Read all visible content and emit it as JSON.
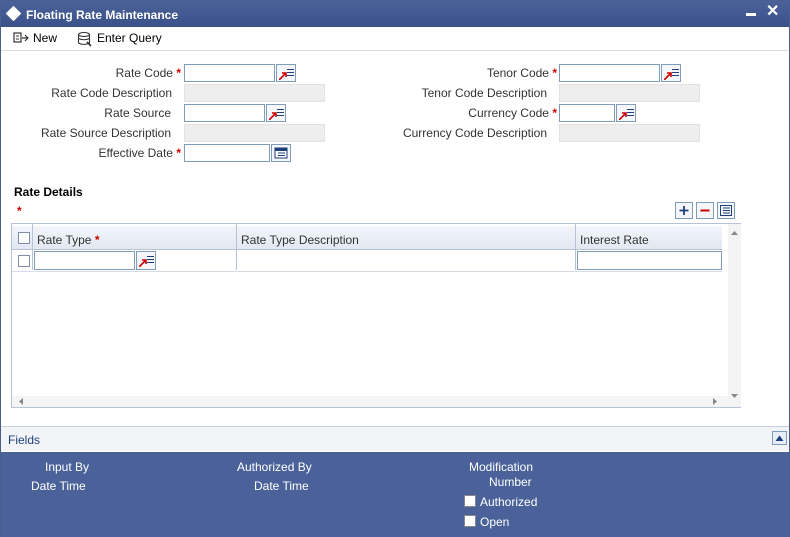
{
  "window": {
    "title": "Floating Rate Maintenance"
  },
  "toolbar": {
    "new_label": "New",
    "enter_query_label": "Enter Query"
  },
  "form": {
    "rate_code_label": "Rate Code",
    "rate_code_desc_label": "Rate Code Description",
    "rate_source_label": "Rate Source",
    "rate_source_desc_label": "Rate Source Description",
    "effective_date_label": "Effective Date",
    "tenor_code_label": "Tenor Code",
    "tenor_code_desc_label": "Tenor Code Description",
    "currency_code_label": "Currency Code",
    "currency_code_desc_label": "Currency Code Description",
    "required_mark": "*"
  },
  "rate_details": {
    "section_title": "Rate Details",
    "required_mark": "*",
    "columns": [
      "Rate Type",
      "Rate Type Description",
      "Interest Rate"
    ],
    "column_required_mark": "*"
  },
  "footer": {
    "fields_link": "Fields",
    "input_by": "Input By",
    "date_time_1": "Date Time",
    "authorized_by": "Authorized By",
    "date_time_2": "Date Time",
    "modification": "Modification",
    "number": "Number",
    "authorized": "Authorized",
    "open": "Open"
  },
  "colors": {
    "titlebar": "#3a5289",
    "footer": "#4a6299",
    "required": "#cc0000",
    "link": "#1d3f7a"
  },
  "icons": [
    "diamond-icon",
    "minimize-icon",
    "close-icon",
    "new-icon",
    "enter-query-icon",
    "lov-icon",
    "calendar-icon",
    "add-row-icon",
    "delete-row-icon",
    "single-view-icon",
    "scroll-up-icon"
  ]
}
